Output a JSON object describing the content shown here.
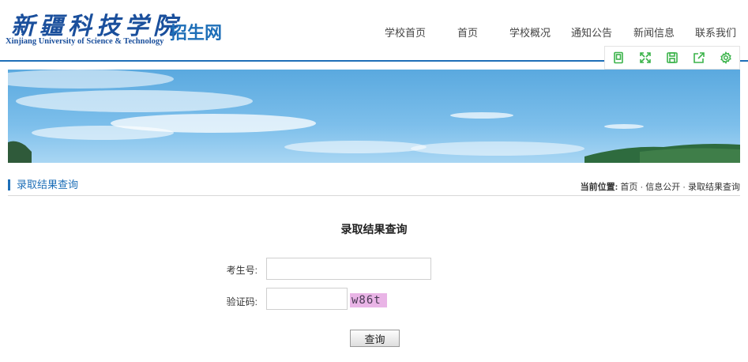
{
  "logo": {
    "chinese": "新疆科技学院",
    "english": "Xinjiang University of Science & Technology"
  },
  "site_name": "招生网",
  "nav": {
    "items": [
      {
        "label": "学校首页"
      },
      {
        "label": "首页"
      },
      {
        "label": "学校概况"
      },
      {
        "label": "通知公告"
      },
      {
        "label": "新闻信息"
      },
      {
        "label": "联系我们"
      }
    ]
  },
  "toolbar": {
    "icons": [
      "reader-icon",
      "fullscreen-icon",
      "save-icon",
      "share-icon",
      "settings-icon"
    ],
    "color": "#3bb34a"
  },
  "section": {
    "title": "录取结果查询",
    "breadcrumb": {
      "label": "当前位置:",
      "items": [
        "首页",
        "信息公开",
        "录取结果查询"
      ],
      "separator": "·"
    }
  },
  "form": {
    "title": "录取结果查询",
    "exam_no_label": "考生号:",
    "exam_no_value": "",
    "captcha_label": "验证码:",
    "captcha_value": "",
    "captcha_text": "w86t",
    "submit_label": "查询"
  },
  "colors": {
    "brand": "#1e6fb8",
    "icon": "#3bb34a",
    "captcha_bg": "#e9b4e6"
  }
}
